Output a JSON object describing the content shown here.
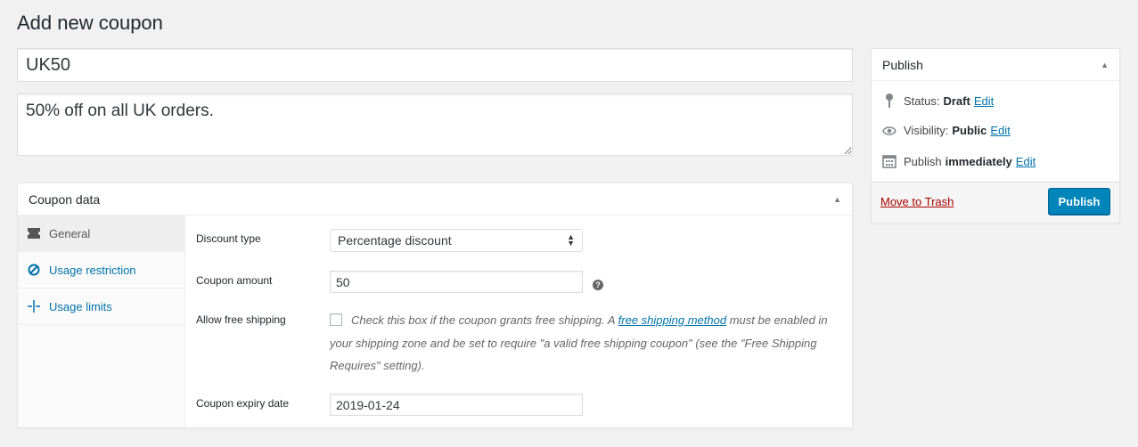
{
  "page": {
    "title": "Add new coupon"
  },
  "coupon": {
    "code": "UK50",
    "description": "50% off on all UK orders."
  },
  "coupon_data": {
    "heading": "Coupon data",
    "tabs": [
      {
        "label": "General",
        "icon": "ticket-icon"
      },
      {
        "label": "Usage restriction",
        "icon": "restriction-icon"
      },
      {
        "label": "Usage limits",
        "icon": "limits-icon"
      }
    ],
    "general": {
      "discount_type_label": "Discount type",
      "discount_type_value": "Percentage discount",
      "coupon_amount_label": "Coupon amount",
      "coupon_amount_value": "50",
      "free_shipping_label": "Allow free shipping",
      "free_shipping_desc_pre": "Check this box if the coupon grants free shipping. A ",
      "free_shipping_link": "free shipping method",
      "free_shipping_desc_post": " must be enabled in your shipping zone and be set to require \"a valid free shipping coupon\" (see the \"Free Shipping Requires\" setting).",
      "expiry_label": "Coupon expiry date",
      "expiry_value": "2019-01-24"
    }
  },
  "publish": {
    "heading": "Publish",
    "status_label": "Status:",
    "status_value": "Draft",
    "visibility_label": "Visibility:",
    "visibility_value": "Public",
    "schedule_label": "Publish",
    "schedule_value": "immediately",
    "edit_label": "Edit",
    "trash_label": "Move to Trash",
    "button_label": "Publish"
  },
  "colors": {
    "accent": "#0073aa",
    "button": "#0085ba",
    "danger": "#a00"
  }
}
